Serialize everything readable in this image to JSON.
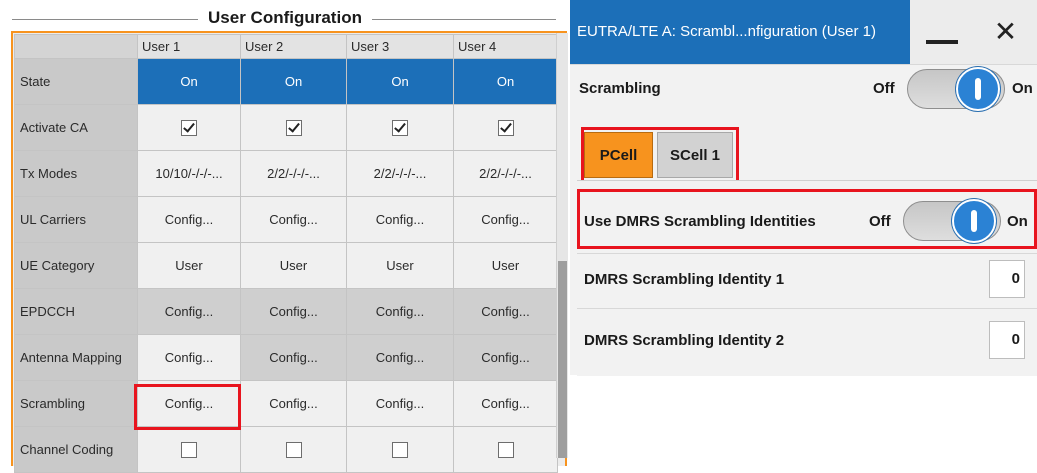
{
  "left_panel": {
    "title": "User Configuration",
    "columns": [
      "User 1",
      "User 2",
      "User 3",
      "User 4"
    ],
    "rows": [
      {
        "label": "State",
        "cells": [
          "On",
          "On",
          "On",
          "On"
        ]
      },
      {
        "label": "Activate CA",
        "checkboxes": [
          true,
          true,
          true,
          true
        ]
      },
      {
        "label": "Tx Modes",
        "cells": [
          "10/10/-/-/-...",
          "2/2/-/-/-...",
          "2/2/-/-/-...",
          "2/2/-/-/-..."
        ]
      },
      {
        "label": "UL Carriers",
        "cells": [
          "Config...",
          "Config...",
          "Config...",
          "Config..."
        ]
      },
      {
        "label": "UE Category",
        "cells": [
          "User",
          "User",
          "User",
          "User"
        ]
      },
      {
        "label": "EPDCCH",
        "cells": [
          "Config...",
          "Config...",
          "Config...",
          "Config..."
        ]
      },
      {
        "label": "Antenna Mapping",
        "cells": [
          "Config...",
          "Config...",
          "Config...",
          "Config..."
        ]
      },
      {
        "label": "Scrambling",
        "cells": [
          "Config...",
          "Config...",
          "Config...",
          "Config..."
        ]
      },
      {
        "label": "Channel Coding",
        "checkboxes": [
          false,
          false,
          false,
          false
        ]
      }
    ],
    "colors": {
      "accent": "#f7931e",
      "state_on": "#1c6fb8",
      "highlight": "#e8141e"
    }
  },
  "dialog": {
    "title": "EUTRA/LTE A: Scrambl...nfiguration (User 1)",
    "scrambling": {
      "label": "Scrambling",
      "off": "Off",
      "on": "On"
    },
    "tabs": [
      {
        "label": "PCell"
      },
      {
        "label": "SCell 1"
      }
    ],
    "use_dmrs": {
      "label": "Use DMRS Scrambling Identities",
      "off": "Off",
      "on": "On"
    },
    "dmrs_id1": {
      "label": "DMRS Scrambling Identity 1",
      "value": "0"
    },
    "dmrs_id2": {
      "label": "DMRS Scrambling Identity 2",
      "value": "0"
    }
  }
}
